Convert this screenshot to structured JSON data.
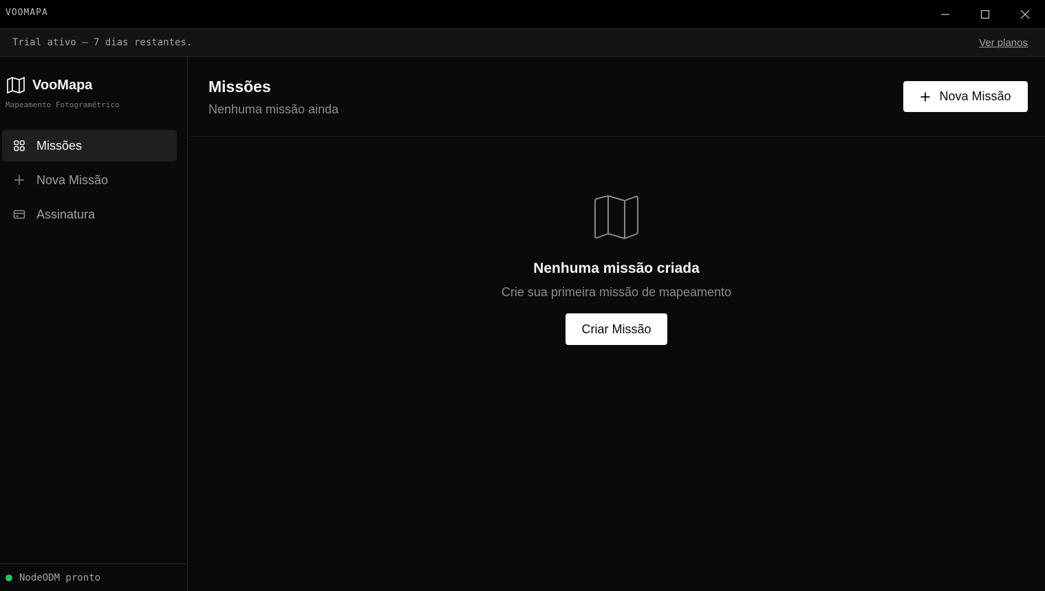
{
  "window": {
    "app_name": "VOOMAPA",
    "controls": {
      "minimize": "minimize-icon",
      "maximize": "maximize-icon",
      "close": "close-icon"
    }
  },
  "banner": {
    "text": "Trial ativo — 7 dias restantes.",
    "link": "Ver planos"
  },
  "sidebar": {
    "brand_icon": "map-icon",
    "brand_name": "VooMapa",
    "brand_subtitle": "Mapeamento Fotogramétrico",
    "items": [
      {
        "label": "Missões",
        "icon": "grid-icon",
        "active": true
      },
      {
        "label": "Nova Missão",
        "icon": "plus-icon",
        "active": false
      },
      {
        "label": "Assinatura",
        "icon": "credit-card-icon",
        "active": false
      }
    ],
    "status": {
      "text": "NodeODM pronto",
      "color": "#22c55e"
    }
  },
  "main": {
    "title": "Missões",
    "subtitle": "Nenhuma missão ainda",
    "new_button": "Nova Missão",
    "empty": {
      "icon": "map-icon",
      "title": "Nenhuma missão criada",
      "subtitle": "Crie sua primeira missão de mapeamento",
      "button": "Criar Missão"
    }
  },
  "colors": {
    "background": "#0a0a0a",
    "accent": "#ffffff",
    "status_ready": "#22c55e"
  }
}
